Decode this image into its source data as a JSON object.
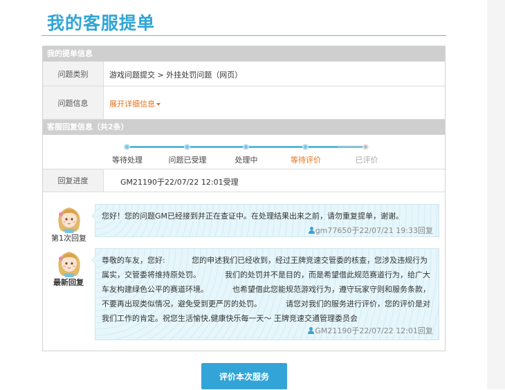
{
  "page": {
    "title": "我的客服提单"
  },
  "ticket_section": {
    "header": "我的提单信息",
    "category_label": "问题类别",
    "category_value": "游戏问题提交 > 外挂处罚问题（网页）",
    "info_label": "问题信息",
    "info_link": "展开详细信息"
  },
  "reply_section": {
    "header": "客服回复信息（共2条）",
    "steps": [
      {
        "label": "等待处理",
        "state": "done"
      },
      {
        "label": "问题已受理",
        "state": "done"
      },
      {
        "label": "处理中",
        "state": "done"
      },
      {
        "label": "等待评价",
        "state": "current"
      },
      {
        "label": "已评价",
        "state": "future"
      }
    ],
    "progress_label": "回复进度",
    "progress_value": "GM21190于22/07/22 12:01受理"
  },
  "replies": [
    {
      "tag": "第1次回复",
      "text": "您好！您的问题GM已经接到并正在查证中。在处理结果出来之前，请勿重复提单，谢谢。",
      "meta": "gm77650于22/07/21 19:33回复"
    },
    {
      "tag": "最新回复",
      "text": "尊敬的车友，您好:           您的申述我们已经收到，经过王牌竞速交管委的核查，您涉及违规行为属实，交管委将维持原处罚。          我们的处罚并不是目的，而是希望借此规范赛道行为，给广大车友构建绿色公平的赛道环境。          也希望借此您能规范游戏行为，遵守玩家守则和服务条款，不要再出现类似情况，避免受到更严厉的处罚。          请您对我们的服务进行评价，您的评价是对我们工作的肯定。祝您生活愉快,健康快乐每一天～ 王牌竞速交通管理委员会",
      "meta": "GM21190于22/07/22 12:01回复"
    }
  ],
  "actions": {
    "rate_button": "评价本次服务"
  },
  "colors": {
    "accent": "#2fa5d6",
    "highlight": "#e2731e",
    "header_gray": "#cfcfcf",
    "bubble_bg": "#e6f6fb"
  }
}
